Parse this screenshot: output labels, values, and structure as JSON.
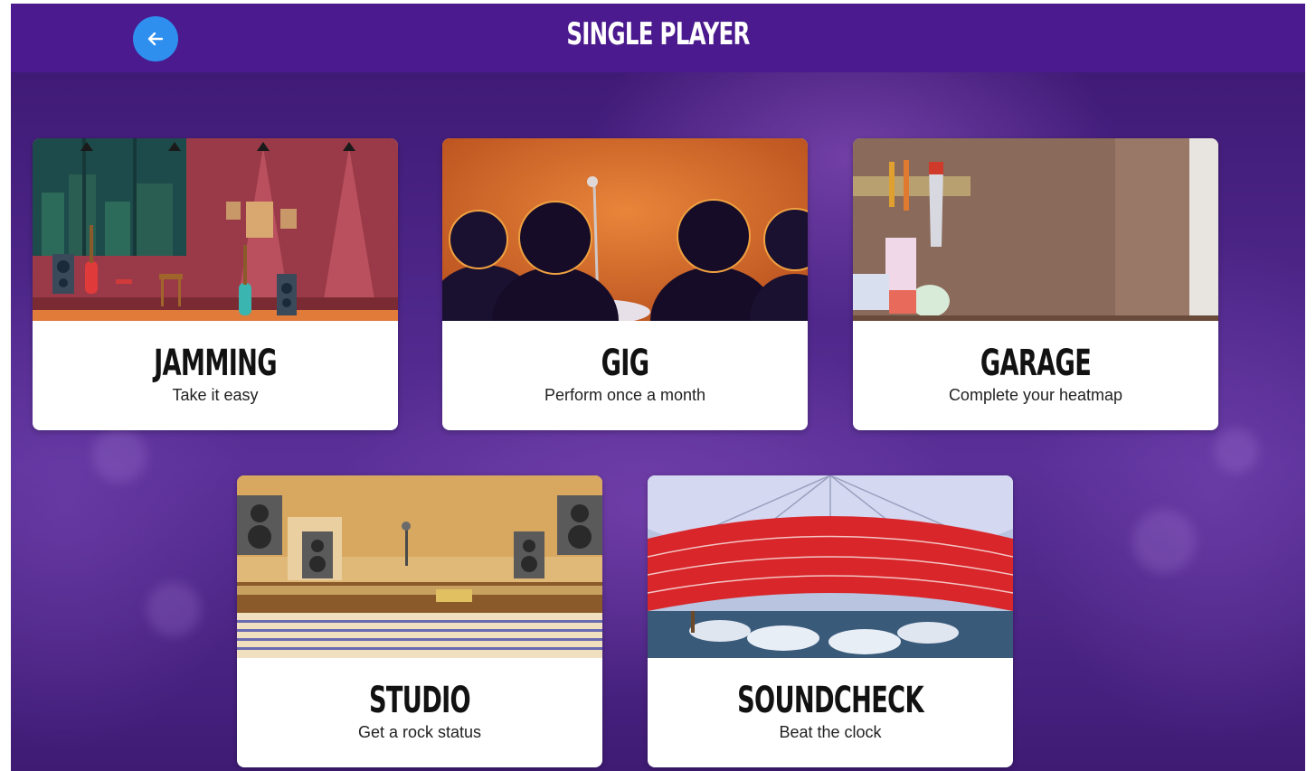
{
  "header": {
    "title": "SINGLE PLAYER",
    "back_icon": "arrow-left-icon"
  },
  "modes": [
    {
      "name": "JAMMING",
      "subtitle": "Take it easy",
      "art": "jamming-stage-illustration"
    },
    {
      "name": "GIG",
      "subtitle": "Perform once a month",
      "art": "gig-audience-illustration"
    },
    {
      "name": "GARAGE",
      "subtitle": "Complete your heatmap",
      "art": "garage-tools-illustration"
    },
    {
      "name": "STUDIO",
      "subtitle": "Get a rock status",
      "art": "studio-mixing-desk-illustration"
    },
    {
      "name": "SOUNDCHECK",
      "subtitle": "Beat the clock",
      "art": "arena-stage-illustration"
    }
  ],
  "colors": {
    "header": "#4a1a8e",
    "back_button": "#2f8fef",
    "card": "#ffffff",
    "card_title": "#121212"
  }
}
